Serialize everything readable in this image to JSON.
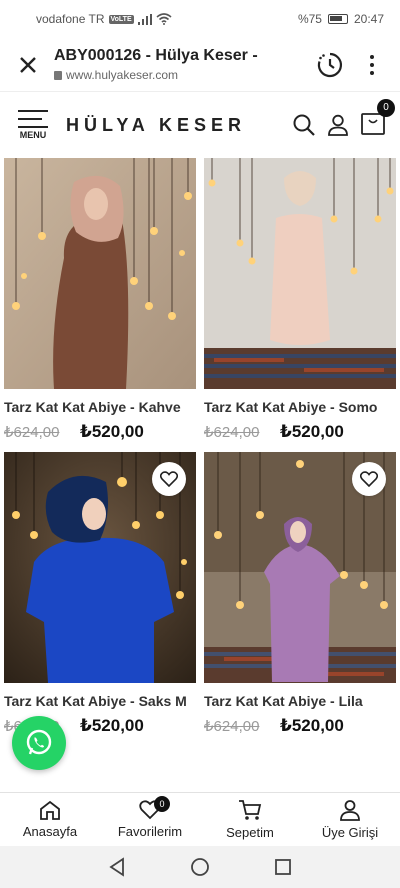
{
  "status_bar": {
    "carrier": "vodafone TR",
    "volte": "VoLTE",
    "battery": "%75",
    "time": "20:47"
  },
  "browser": {
    "title": "ABY000126 - Hülya Keser -",
    "url": "www.hulyakeser.com"
  },
  "header": {
    "menu_label": "MENU",
    "logo": "HÜLYA KESER",
    "cart_count": "0"
  },
  "products": [
    {
      "name": "Tarz Kat Kat Abiye - Kahve",
      "old_price": "₺624,00",
      "new_price": "₺520,00",
      "dress_color": "#7a4a36"
    },
    {
      "name": "Tarz Kat Kat Abiye - Somo",
      "old_price": "₺624,00",
      "new_price": "₺520,00",
      "dress_color": "#efcfc0"
    },
    {
      "name": "Tarz Kat Kat Abiye - Saks M",
      "old_price": "₺624,00",
      "new_price": "₺520,00",
      "dress_color": "#1b47c4"
    },
    {
      "name": "Tarz Kat Kat Abiye - Lila",
      "old_price": "₺624,00",
      "new_price": "₺520,00",
      "dress_color": "#a87ab4"
    }
  ],
  "bottom_nav": [
    {
      "label": "Anasayfa",
      "icon": "home-icon"
    },
    {
      "label": "Favorilerim",
      "icon": "heart-icon",
      "badge": "0"
    },
    {
      "label": "Sepetim",
      "icon": "cart-icon"
    },
    {
      "label": "Üye Girişi",
      "icon": "user-icon"
    }
  ],
  "colors": {
    "whatsapp": "#25d366",
    "accent": "#111111"
  }
}
